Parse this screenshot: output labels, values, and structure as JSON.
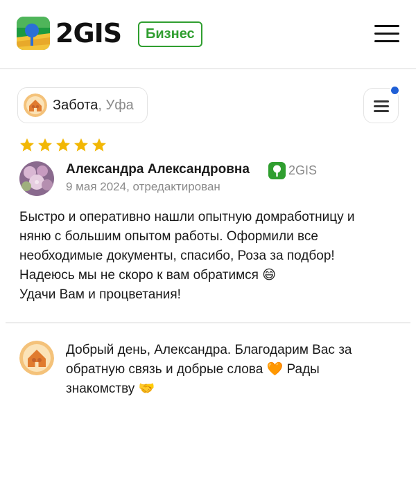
{
  "header": {
    "logo_text": "2GIS",
    "badge_label": "Бизнес",
    "menu_icon": "hamburger-menu-icon"
  },
  "organization": {
    "name": "Забота",
    "city": ", Уфа"
  },
  "filter": {
    "icon": "filter-lines-icon",
    "has_notification": true,
    "dot_color": "#1f5fd6"
  },
  "review": {
    "rating": 5,
    "star_color": "#f2b705",
    "author": "Александра Александровна",
    "source": "2GIS",
    "date": "9 мая 2024, отредактирован",
    "text_lines": [
      "Быстро и оперативно нашли опытную домработницу и",
      "няню с большим опытом работы. Оформили все",
      "необходимые документы, спасибо, Роза за подбор!",
      "Надеюсь мы не скоро к вам обратимся 😄",
      "Удачи Вам и процветания!"
    ]
  },
  "reply": {
    "text_lines": [
      "Добрый день, Александра. Благодарим Вас за",
      "обратную связь и добрые слова 🧡 Рады",
      "знакомству 🤝"
    ]
  },
  "colors": {
    "brand_green": "#2f9e2f",
    "muted_text": "#8a8a8a"
  }
}
